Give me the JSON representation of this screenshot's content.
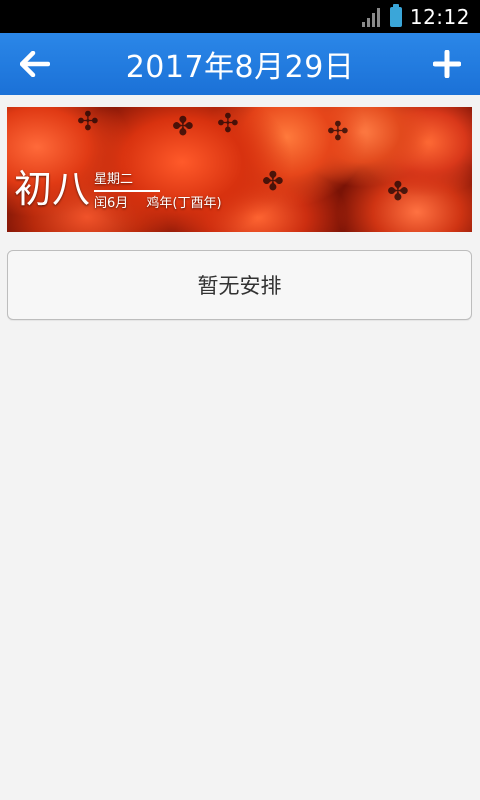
{
  "status_bar": {
    "time": "12:12",
    "signal_icon": "signal-icon",
    "battery_icon": "battery-icon",
    "battery_color": "#3aa6d9"
  },
  "app_bar": {
    "title": "2017年8月29日",
    "back_icon": "arrow-left-icon",
    "add_icon": "plus-icon",
    "color": "#1f7ae0"
  },
  "lunar": {
    "day": "初八",
    "weekday": "星期二",
    "month": "闰6月",
    "year": "鸡年(丁酉年)"
  },
  "schedule": {
    "empty_text": "暂无安排"
  }
}
